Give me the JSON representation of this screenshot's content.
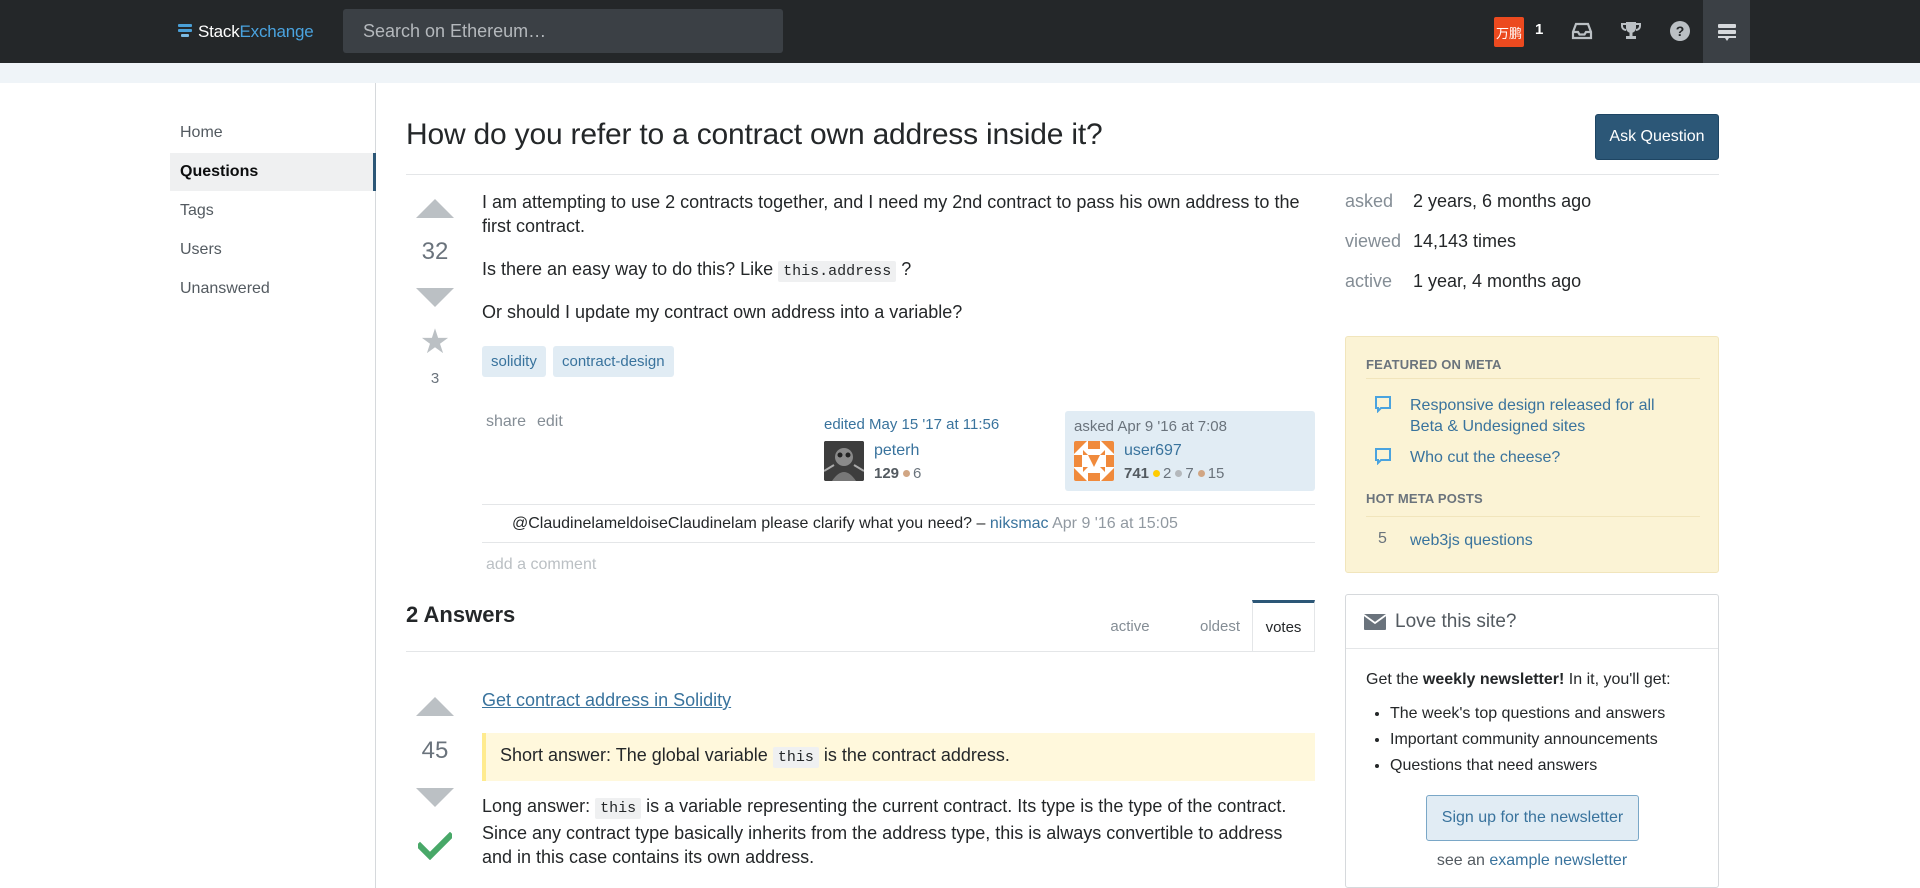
{
  "topbar": {
    "brand_part1": "Stack",
    "brand_part2": "Exchange",
    "search_placeholder": "Search on Ethereum…",
    "user_badge": "万鹏",
    "rep_change": "1",
    "icons": [
      "inbox-icon",
      "achievements-icon",
      "help-icon",
      "site-switcher-icon"
    ]
  },
  "nav": {
    "items": [
      {
        "label": "Home"
      },
      {
        "label": "Questions"
      },
      {
        "label": "Tags"
      },
      {
        "label": "Users"
      },
      {
        "label": "Unanswered"
      }
    ],
    "active": "Questions"
  },
  "question": {
    "title": "How do you refer to a contract own address inside it?",
    "ask_button": "Ask Question",
    "votes": "32",
    "favorites": "3",
    "p1": "I am attempting to use 2 contracts together, and I need my 2nd contract to pass his own address to the first contract.",
    "p2_pre": "Is there an easy way to do this? Like ",
    "p2_code": "this.address",
    "p2_post": " ?",
    "p3": "Or should I update my contract own address into a variable?",
    "tags": [
      "solidity",
      "contract-design"
    ],
    "menu": {
      "share": "share",
      "edit": "edit"
    },
    "edited": {
      "label": "edited May 15 '17 at 11:56",
      "user": "peterh",
      "rep": "129",
      "bronze": "6"
    },
    "asked": {
      "label": "asked Apr 9 '16 at 7:08",
      "user": "user697",
      "rep": "741",
      "gold": "2",
      "silver": "7",
      "bronze": "15"
    },
    "comment": {
      "text": "@ClaudinelameldoiseClaudinelam please clarify what you need? – ",
      "user": "niksmac",
      "date": "Apr 9 '16 at 15:05"
    },
    "add_comment": "add a comment"
  },
  "answers": {
    "heading": "2 Answers",
    "tabs": [
      {
        "label": "active"
      },
      {
        "label": "oldest"
      },
      {
        "label": "votes"
      }
    ],
    "active_tab": "votes",
    "first": {
      "votes": "45",
      "link": "Get contract address in Solidity",
      "quote_pre": "Short answer: The global variable ",
      "quote_code": "this",
      "quote_post": " is the contract address.",
      "long_pre": "Long answer: ",
      "long_code": "this",
      "long_post": " is a variable representing the current contract. Its type is the type of the contract. Since any contract type basically inherits from the address type, this is always convertible to address and in this case contains its own address.",
      "accepted": true
    }
  },
  "stats": {
    "asked_label": "asked",
    "asked_value": "2 years, 6 months ago",
    "viewed_label": "viewed",
    "viewed_value": "14,143 times",
    "active_label": "active",
    "active_value": "1 year, 4 months ago"
  },
  "meta": {
    "featured_heading": "FEATURED ON META",
    "featured": [
      {
        "title": "Responsive design released for all Beta & Undesigned sites"
      },
      {
        "title": "Who cut the cheese?"
      }
    ],
    "hot_heading": "HOT META POSTS",
    "hot": [
      {
        "score": "5",
        "title": "web3js questions"
      }
    ]
  },
  "newsletter": {
    "heading": "Love this site?",
    "intro_pre": "Get the ",
    "intro_bold": "weekly newsletter!",
    "intro_post": " In it, you'll get:",
    "items": [
      "The week's top questions and answers",
      "Important community announcements",
      "Questions that need answers"
    ],
    "button": "Sign up for the newsletter",
    "see_pre": "see an ",
    "see_link": "example newsletter"
  },
  "colors": {
    "topbar": "#242729",
    "accent": "#2c5777",
    "link": "#39739d",
    "tag_bg": "#e1ecf4",
    "meta_bg": "#fbf3d5",
    "accepted": "#48a868",
    "badge_bg": "#ec4a1f"
  }
}
